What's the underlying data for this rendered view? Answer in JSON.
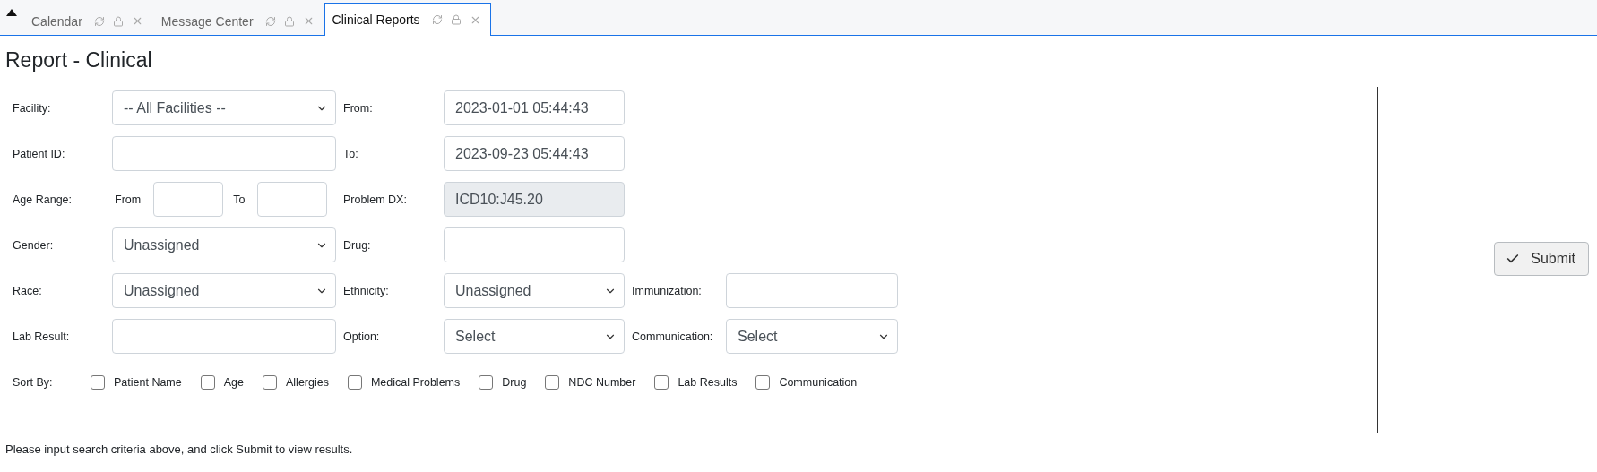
{
  "tabs": [
    {
      "label": "Calendar",
      "selected": false
    },
    {
      "label": "Message Center",
      "selected": false
    },
    {
      "label": "Clinical Reports",
      "selected": true
    }
  ],
  "title": "Report - Clinical",
  "form_rows": [
    [
      {
        "label": "Facility:",
        "kind": "select",
        "value": "-- All Facilities --"
      },
      {
        "label": "From:",
        "kind": "text",
        "value": "2023-01-01 05:44:43",
        "disabled": false
      }
    ],
    [
      {
        "label": "Patient ID:",
        "kind": "text",
        "disabled": false
      },
      {
        "label": "To:",
        "kind": "text",
        "value": "2023-09-23 05:44:43",
        "disabled": false
      }
    ],
    [
      {
        "label": "Age Range:",
        "kind": "range",
        "from_label": "From",
        "to_label": "To"
      },
      {
        "label": "Problem DX:",
        "kind": "text",
        "value": "ICD10:J45.20",
        "disabled": true
      }
    ],
    [
      {
        "label": "Gender:",
        "kind": "select",
        "value": "Unassigned"
      },
      {
        "label": "Drug:",
        "kind": "text",
        "disabled": false
      }
    ],
    [
      {
        "label": "Race:",
        "kind": "select",
        "value": "Unassigned"
      },
      {
        "label": "Ethnicity:",
        "kind": "select",
        "value": "Unassigned"
      },
      {
        "label": "Immunization:",
        "kind": "text",
        "disabled": false
      }
    ],
    [
      {
        "label": "Lab Result:",
        "kind": "text",
        "disabled": false
      },
      {
        "label": "Option:",
        "kind": "select",
        "value": "Select"
      },
      {
        "label": "Communication:",
        "kind": "select",
        "value": "Select"
      }
    ]
  ],
  "sort_by": {
    "label": "Sort By:",
    "options": [
      {
        "label": "Patient Name",
        "checked": false
      },
      {
        "label": "Age",
        "checked": false
      },
      {
        "label": "Allergies",
        "checked": false
      },
      {
        "label": "Medical Problems",
        "checked": false
      },
      {
        "label": "Drug",
        "checked": false
      },
      {
        "label": "NDC Number",
        "checked": false
      },
      {
        "label": "Lab Results",
        "checked": false
      },
      {
        "label": "Communication",
        "checked": false
      }
    ]
  },
  "submit_button": "Submit",
  "footer_text": "Please input search criteria above, and click Submit to view results."
}
